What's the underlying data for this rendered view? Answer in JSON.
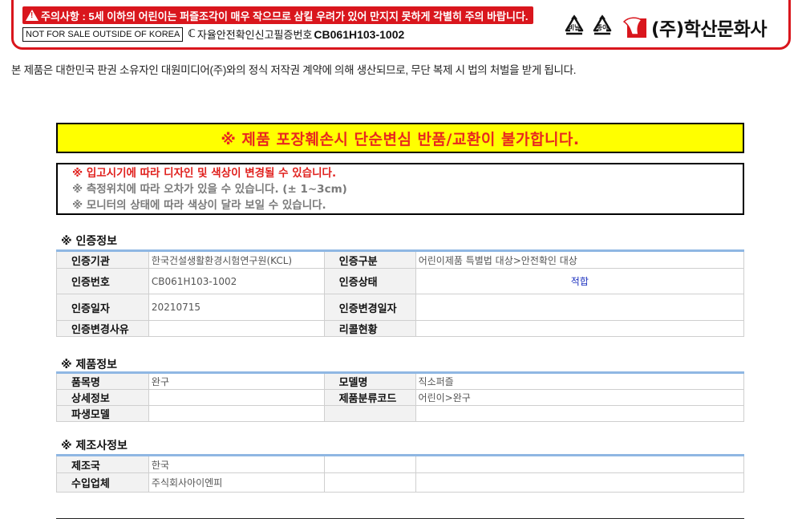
{
  "package": {
    "warning": "주의사항 : 5세 이하의 어린이는 퍼즐조각이 매우 작으므로 삼킬 우려가 있어 만지지 못하게 각별히 주의 바랍니다.",
    "not_for_sale": "NOT FOR SALE OUTSIDE OF KOREA",
    "cert_label": "자율안전확인신고필증번호",
    "cert_code": "CB061H103-1002",
    "recycle_marks": [
      {
        "label": "비닐",
        "icon": "recycle-icon"
      },
      {
        "label": "종이",
        "icon": "recycle-icon"
      }
    ],
    "brand": "(주)학산문화사",
    "brand_color": "#d9161d"
  },
  "copyright": "본 제품은 대한민국 판권 소유자인 대원미디어(주)와의 정식 저작권 계약에 의해 생산되므로, 무단 복제 시 법의 처벌을 받게 됩니다.",
  "notice": {
    "headline": "※ 제품 포장훼손시 단순변심 반품/교환이 불가합니다.",
    "lines": [
      "※ 입고시기에 따라 디자인 및 색상이 변경될 수 있습니다.",
      "※ 측정위치에 따라 오차가 있을 수 있습니다. (± 1~3cm)",
      "※ 모니터의 상태에 따라 색상이 달라 보일 수 있습니다."
    ]
  },
  "certification": {
    "title": "※ 인증정보",
    "rows": [
      [
        "인증기관",
        "한국건설생활환경시험연구원(KCL)",
        "인증구분",
        "어린이제품 특별법 대상>안전확인 대상"
      ],
      [
        "인증번호",
        "CB061H103-1002",
        "인증상태",
        "적합"
      ],
      [
        "인증일자",
        "20210715",
        "인증변경일자",
        ""
      ],
      [
        "인증변경사유",
        "",
        "리콜현황",
        ""
      ]
    ]
  },
  "product": {
    "title": "※ 제품정보",
    "rows": [
      [
        "품목명",
        "완구",
        "모델명",
        "직소퍼즐"
      ],
      [
        "상세정보",
        "",
        "제품분류코드",
        "어린이>완구"
      ],
      [
        "파생모델",
        "",
        "",
        ""
      ]
    ]
  },
  "manufacturer": {
    "title": "※ 제조사정보",
    "rows": [
      [
        "제조국",
        "한국",
        "",
        ""
      ],
      [
        "수입업체",
        "주식회사아이엔피",
        "",
        ""
      ]
    ]
  }
}
